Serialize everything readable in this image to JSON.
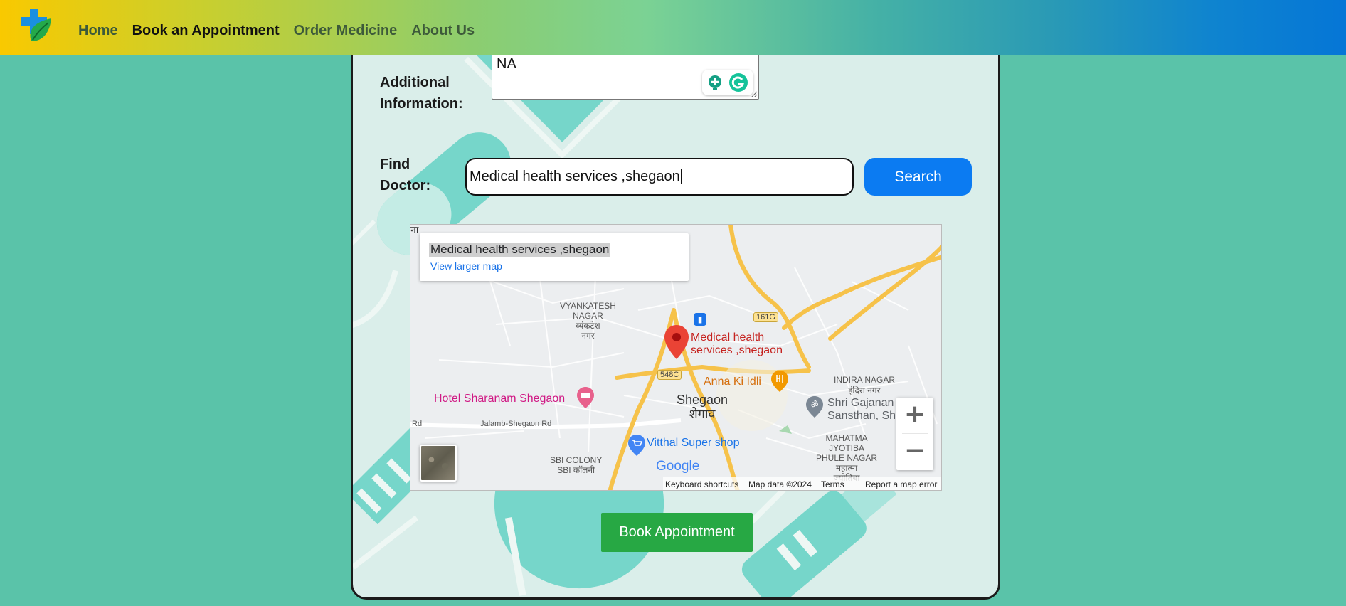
{
  "nav": {
    "links": [
      "Home",
      "Book an Appointment",
      "Order Medicine",
      "About Us"
    ],
    "active_index": 1
  },
  "form": {
    "additional_info_label_line1": "Additional",
    "additional_info_label_line2": "Information:",
    "additional_info_value": "NA",
    "find_doctor_label_line1": "Find",
    "find_doctor_label_line2": "Doctor:",
    "search_value": "Medical health services ,shegaon",
    "search_button": "Search",
    "book_button": "Book Appointment"
  },
  "map": {
    "place_title": "Medical health services ,shegaon",
    "view_larger": "View larger map",
    "pin_label_line1": "Medical health",
    "pin_label_line2": "services ,shegaon",
    "labels": {
      "vyankatesh_1": "VYANKATESH",
      "vyankatesh_2": "NAGAR",
      "vyankatesh_3": "व्यंकटेश",
      "vyankatesh_4": "नगर",
      "anna": "Anna Ki Idli",
      "hotel": "Hotel Sharanam Shegaon",
      "shegaon": "Shegaon",
      "shegaon_dev": "शेगाव",
      "vitthal": "Vitthal Super shop",
      "sbi_1": "SBI COLONY",
      "sbi_2": "SBI कॉलनी",
      "indira_1": "INDIRA NAGAR",
      "indira_2": "इंदिरा नगर",
      "gajanan_1": "Shri Gajanan",
      "gajanan_2": "Sansthan, Sh",
      "mahatma_1": "MAHATMA",
      "mahatma_2": "JYOTIBA",
      "mahatma_3": "PHULE NAGAR",
      "mahatma_4": "महात्मा",
      "mahatma_5": "ज्योतिबा",
      "road_jalamb": "Jalamb-Shegaon Rd",
      "road_rd": "Rd",
      "shield_161g": "161G",
      "shield_548c": "548C",
      "edge_top_left": "ना"
    },
    "zoom_in": "+",
    "zoom_out": "−",
    "footer": {
      "shortcuts": "Keyboard shortcuts",
      "data": "Map data ©2024",
      "terms": "Terms",
      "report": "Report a map error"
    },
    "google": "Google"
  },
  "colors": {
    "page_bg": "#5ac3a9",
    "search_btn": "#0b7bf2",
    "book_btn": "#27a844",
    "pin": "#ea4335",
    "route": "#f6c24a"
  },
  "icons": [
    "logo-cross-leaf-icon",
    "grammarly-icon",
    "map-pin-icon",
    "hotel-icon",
    "restaurant-icon",
    "temple-icon",
    "shopping-cart-icon",
    "transit-icon"
  ]
}
